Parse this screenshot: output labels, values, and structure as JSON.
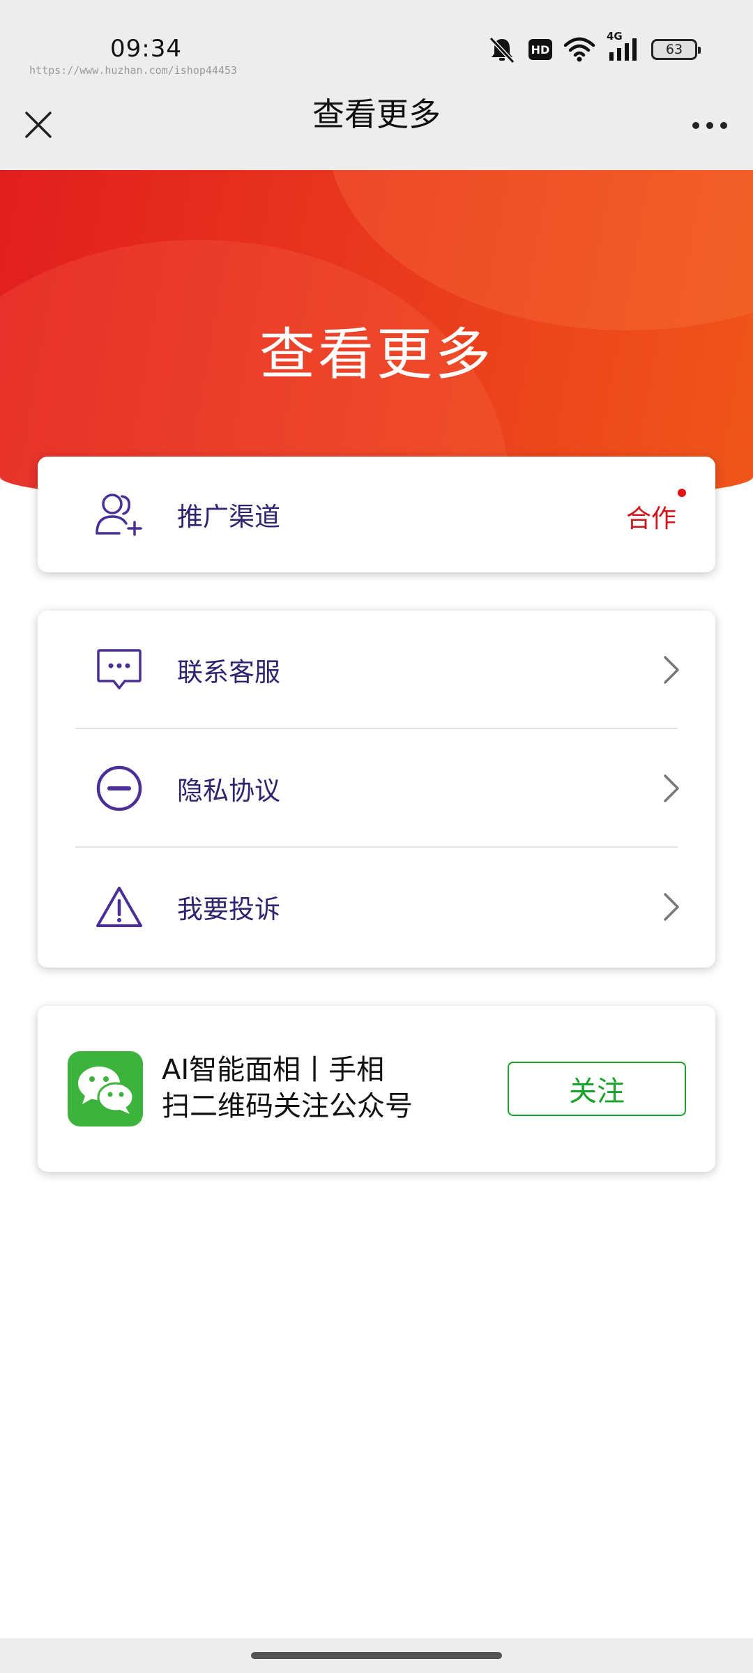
{
  "status_bar": {
    "time": "09:34",
    "watermark": "https://www.huzhan.com/ishop44453",
    "hd_label": "HD",
    "network_label": "4G",
    "battery": "63"
  },
  "nav": {
    "title": "查看更多"
  },
  "hero": {
    "title": "查看更多"
  },
  "promo": {
    "label": "推广渠道",
    "tag": "合作"
  },
  "menu": {
    "items": [
      {
        "label": "联系客服",
        "icon": "chat-bubble-icon"
      },
      {
        "label": "隐私协议",
        "icon": "minus-circle-icon"
      },
      {
        "label": "我要投诉",
        "icon": "warning-triangle-icon"
      }
    ]
  },
  "follow": {
    "title": "AI智能面相丨手相",
    "subtitle": "扫二维码关注公众号",
    "button_label": "关注"
  },
  "colors": {
    "accent_text": "#2e2470",
    "tag_red": "#d0161c",
    "wechat_green": "#3db33d",
    "button_green": "#1aa32a",
    "hero_start": "#e11e1e",
    "hero_end": "#f0561a"
  }
}
